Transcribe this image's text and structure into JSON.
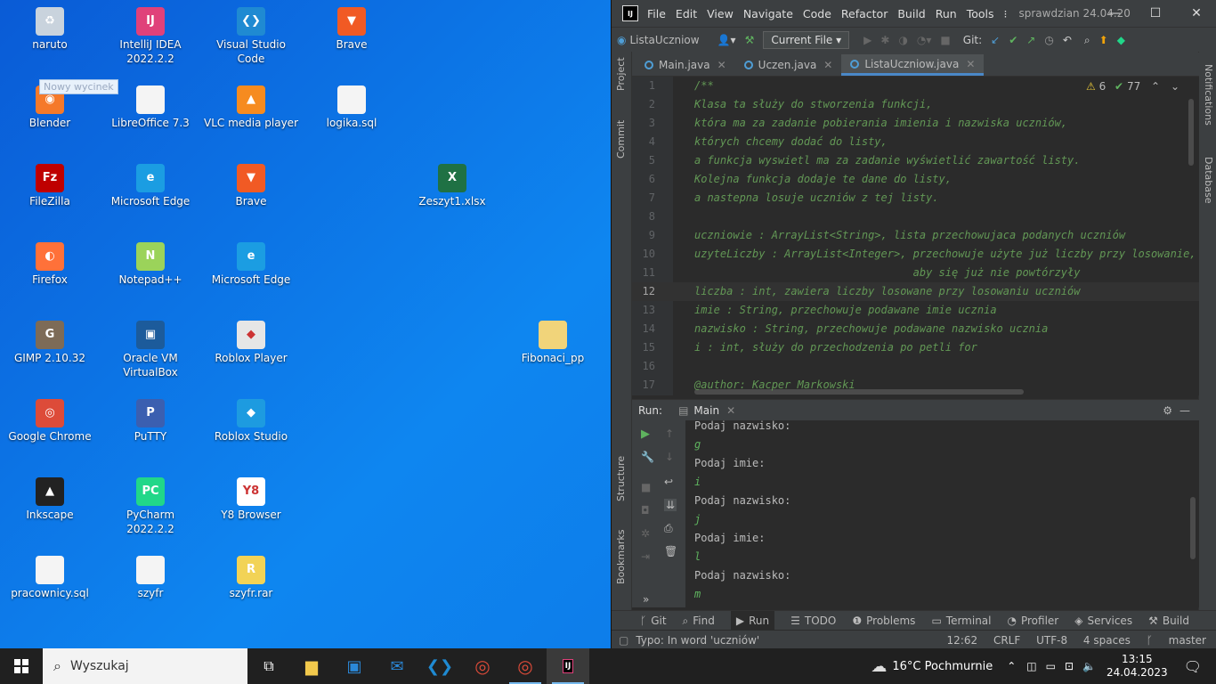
{
  "desktop": {
    "tooltip": "Nowy wycinek",
    "icons": [
      {
        "label": "naruto",
        "color": "#c9d3dd",
        "glyph": "♻"
      },
      {
        "label": "IntelliJ IDEA 2022.2.2",
        "color": "#e0417a",
        "glyph": "IJ"
      },
      {
        "label": "Visual Studio Code",
        "color": "#1f8ad2",
        "glyph": "❮❯"
      },
      {
        "label": "Brave",
        "color": "#f15a24",
        "glyph": "▼"
      },
      {
        "label": "Blender",
        "color": "#f5792a",
        "glyph": "◉"
      },
      {
        "label": "LibreOffice 7.3",
        "color": "#f4f4f4",
        "glyph": ""
      },
      {
        "label": "VLC media player",
        "color": "#f68b1f",
        "glyph": "▲"
      },
      {
        "label": "logika.sql",
        "color": "#f4f4f4",
        "glyph": ""
      },
      {
        "label": "FileZilla",
        "color": "#bf0000",
        "glyph": "Fz"
      },
      {
        "label": "Microsoft Edge",
        "color": "#1b9de2",
        "glyph": "e"
      },
      {
        "label": "Brave",
        "color": "#f15a24",
        "glyph": "▼"
      },
      {
        "label": "Zeszyt1.xlsx",
        "color": "#1f7144",
        "glyph": "X"
      },
      {
        "label": "Firefox",
        "color": "#ff7139",
        "glyph": "◐"
      },
      {
        "label": "Notepad++",
        "color": "#9bd35a",
        "glyph": "N"
      },
      {
        "label": "Microsoft Edge",
        "color": "#1b9de2",
        "glyph": "e"
      },
      {
        "label": "GIMP 2.10.32",
        "color": "#7d6b57",
        "glyph": "G"
      },
      {
        "label": "Oracle VM VirtualBox",
        "color": "#1c5b9b",
        "glyph": "▣"
      },
      {
        "label": "Roblox Player",
        "color": "#e6e6e6",
        "glyph": "◆"
      },
      {
        "label": "Fibonaci_pp",
        "color": "#f1d47a",
        "glyph": ""
      },
      {
        "label": "Google Chrome",
        "color": "#dd4b39",
        "glyph": "◎"
      },
      {
        "label": "PuTTY",
        "color": "#3b5fb0",
        "glyph": "P"
      },
      {
        "label": "Roblox Studio",
        "color": "#1d9be0",
        "glyph": "◆"
      },
      {
        "label": "Inkscape",
        "color": "#222222",
        "glyph": "▲"
      },
      {
        "label": "PyCharm 2022.2.2",
        "color": "#21d789",
        "glyph": "PC"
      },
      {
        "label": "Y8 Browser",
        "color": "#ffffff",
        "glyph": "Y8"
      },
      {
        "label": "pracownicy.sql",
        "color": "#f4f4f4",
        "glyph": ""
      },
      {
        "label": "szyfr",
        "color": "#f4f4f4",
        "glyph": ""
      },
      {
        "label": "szyfr.rar",
        "color": "#f2d356",
        "glyph": "R"
      }
    ]
  },
  "ide": {
    "menu": [
      "File",
      "Edit",
      "View",
      "Navigate",
      "Code",
      "Refactor",
      "Build",
      "Run",
      "Tools",
      "⁝"
    ],
    "project_title": "sprawdzian 24.04.20",
    "breadcrumb": "ListaUczniow",
    "run_config": "Current File",
    "git_label": "Git:",
    "tabs": [
      {
        "label": "Main.java",
        "active": false
      },
      {
        "label": "Uczen.java",
        "active": false
      },
      {
        "label": "ListaUczniow.java",
        "active": true
      }
    ],
    "inspections": {
      "warnings": "6",
      "ok": "77"
    },
    "left_tools": [
      "Project",
      "Commit",
      "Structure",
      "Bookmarks"
    ],
    "right_tools": [
      "Notifications",
      "Database"
    ],
    "code_lines": [
      {
        "n": "1",
        "t": "/**"
      },
      {
        "n": "2",
        "t": "Klasa ta służy do stworzenia funkcji,"
      },
      {
        "n": "3",
        "t": "która ma za zadanie pobierania imienia i nazwiska uczniów,"
      },
      {
        "n": "4",
        "t": "których chcemy dodać do listy,"
      },
      {
        "n": "5",
        "t": "a funkcja wyswietl ma za zadanie wyświetlić zawartość listy."
      },
      {
        "n": "6",
        "t": "Kolejna funkcja dodaje te dane do listy,"
      },
      {
        "n": "7",
        "t": "a nastepna losuje uczniów z tej listy."
      },
      {
        "n": "8",
        "t": ""
      },
      {
        "n": "9",
        "t": "uczniowie : ArrayList<String>, lista przechowujaca podanych uczniów"
      },
      {
        "n": "10",
        "t": "uzyteLiczby : ArrayList<Integer>, przechowuje użyte już liczby przy losowanie,"
      },
      {
        "n": "11",
        "t": "                                  aby się już nie powtórzyły"
      },
      {
        "n": "12",
        "t": "liczba : int, zawiera liczby losowane przy losowaniu uczniów"
      },
      {
        "n": "13",
        "t": "imie : String, przechowuje podawane imie ucznia"
      },
      {
        "n": "14",
        "t": "nazwisko : String, przechowuje podawane nazwisko ucznia"
      },
      {
        "n": "15",
        "t": "i : int, służy do przechodzenia po petli for"
      },
      {
        "n": "16",
        "t": ""
      },
      {
        "n": "17",
        "t": "@author: Kacper Markowski"
      }
    ],
    "run_label": "Run:",
    "run_tab": "Main",
    "console_lines": [
      {
        "t": "Podaj nazwisko:",
        "kind": "out"
      },
      {
        "t": "g",
        "kind": "in"
      },
      {
        "t": "Podaj imie:",
        "kind": "out"
      },
      {
        "t": "i",
        "kind": "in"
      },
      {
        "t": "Podaj nazwisko:",
        "kind": "out"
      },
      {
        "t": "j",
        "kind": "in"
      },
      {
        "t": "Podaj imie:",
        "kind": "out"
      },
      {
        "t": "l",
        "kind": "in"
      },
      {
        "t": "Podaj nazwisko:",
        "kind": "out"
      },
      {
        "t": "m",
        "kind": "in"
      }
    ],
    "bottom_tabs": [
      {
        "label": "Git",
        "icon": "ᚴ"
      },
      {
        "label": "Find",
        "icon": "⌕"
      },
      {
        "label": "Run",
        "icon": "▶"
      },
      {
        "label": "TODO",
        "icon": "☰"
      },
      {
        "label": "Problems",
        "icon": "❶"
      },
      {
        "label": "Terminal",
        "icon": "▭"
      },
      {
        "label": "Profiler",
        "icon": "◔"
      },
      {
        "label": "Services",
        "icon": "◈"
      },
      {
        "label": "Build",
        "icon": "⚒"
      }
    ],
    "status": {
      "message": "Typo: In word 'uczniów'",
      "position": "12:62",
      "line_sep": "CRLF",
      "encoding": "UTF-8",
      "indent": "4 spaces",
      "branch": "master"
    }
  },
  "taskbar": {
    "search_placeholder": "Wyszukaj",
    "weather": "16°C  Pochmurnie",
    "time": "13:15",
    "date": "24.04.2023"
  }
}
